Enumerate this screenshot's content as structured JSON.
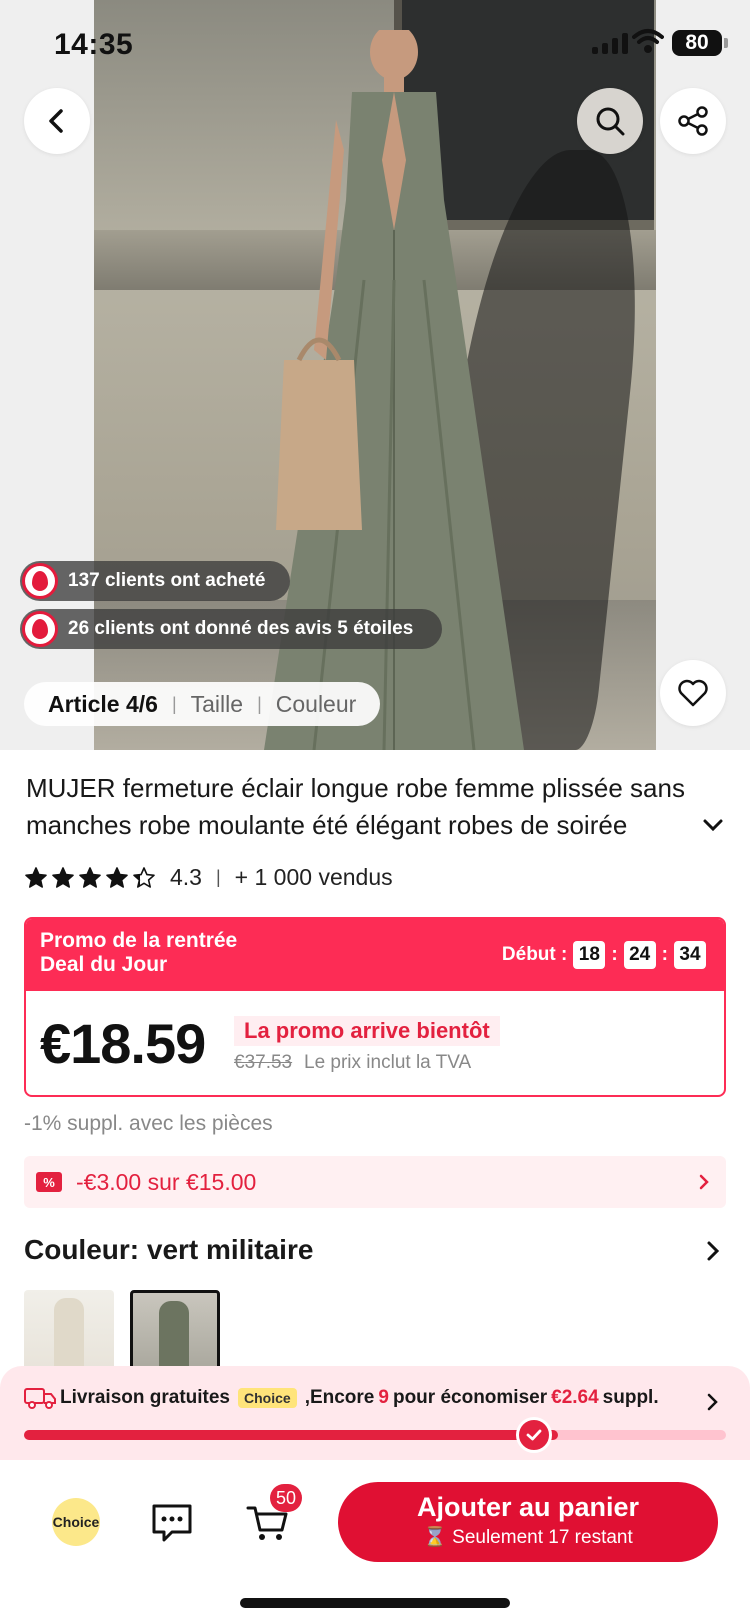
{
  "status_bar": {
    "time": "14:35",
    "battery": "80"
  },
  "gallery": {
    "social_proof": [
      "137 clients ont acheté",
      "26 clients ont donné des avis 5 étoiles"
    ],
    "article_tabs": [
      "Article 4/6",
      "Taille",
      "Couleur"
    ]
  },
  "product": {
    "title": "MUJER fermeture éclair longue robe femme plissée sans manches robe moulante été élégant robes de soirée",
    "rating": "4.3",
    "rating_stars": 4.3,
    "sold": "+ 1 000 vendus"
  },
  "promo": {
    "line1": "Promo de la rentrée",
    "line2": "Deal du Jour",
    "countdown_label": "Début :",
    "countdown": [
      "18",
      "24",
      "34"
    ],
    "price": "€18.59",
    "soon": "La promo arrive bientôt",
    "old_price": "€37.53",
    "vat": "Le prix inclut la TVA"
  },
  "coins": "-1% suppl. avec les pièces",
  "coupon": {
    "icon": "%",
    "text": "-€3.00 sur €15.00"
  },
  "color": {
    "label": "Couleur: vert militaire"
  },
  "shipping": {
    "text1": "Livraison gratuites",
    "choice_tag": "Choice",
    "text2": ",Encore",
    "count": "9",
    "text3": "pour économiser",
    "amount": "€2.64",
    "text4": "suppl.",
    "progress": 0.76
  },
  "bottom_bar": {
    "choice": "Choice",
    "cart_count": "50",
    "cta_main": "Ajouter au panier",
    "cta_sub": "⌛ Seulement 17 restant"
  },
  "colors": {
    "accent": "#e3213f",
    "promo": "#fd2c55"
  }
}
